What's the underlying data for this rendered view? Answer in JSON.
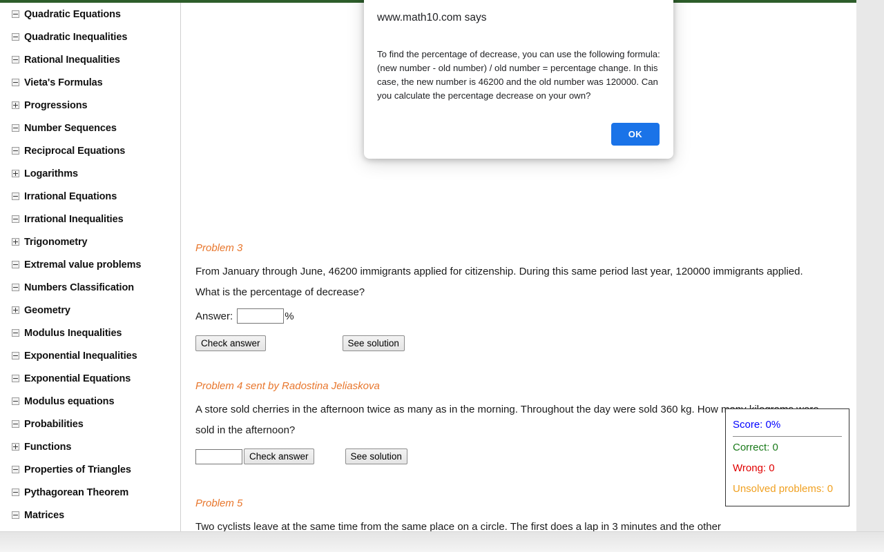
{
  "theme": {
    "top_bar_color": "#2d5d2a",
    "accent_orange": "#e8762c",
    "dialog_button_blue": "#1a73e8",
    "score_blue": "#0000ff",
    "correct_green": "#1a7a1a",
    "wrong_red": "#e00000",
    "unsolved_orange": "#f0a020"
  },
  "sidebar": {
    "items": [
      {
        "label": "Quadratic Equations",
        "toggle": "minus"
      },
      {
        "label": "Quadratic Inequalities",
        "toggle": "minus"
      },
      {
        "label": "Rational Inequalities",
        "toggle": "minus"
      },
      {
        "label": "Vieta's Formulas",
        "toggle": "minus"
      },
      {
        "label": "Progressions",
        "toggle": "plus"
      },
      {
        "label": "Number Sequences",
        "toggle": "minus"
      },
      {
        "label": "Reciprocal Equations",
        "toggle": "minus"
      },
      {
        "label": "Logarithms",
        "toggle": "plus"
      },
      {
        "label": "Irrational Equations",
        "toggle": "minus"
      },
      {
        "label": "Irrational Inequalities",
        "toggle": "minus"
      },
      {
        "label": "Trigonometry",
        "toggle": "plus"
      },
      {
        "label": "Extremal value problems",
        "toggle": "minus"
      },
      {
        "label": "Numbers Classification",
        "toggle": "minus"
      },
      {
        "label": "Geometry",
        "toggle": "plus"
      },
      {
        "label": "Modulus Inequalities",
        "toggle": "minus"
      },
      {
        "label": "Exponential Inequalities",
        "toggle": "minus"
      },
      {
        "label": "Exponential Equations",
        "toggle": "minus"
      },
      {
        "label": "Modulus equations",
        "toggle": "minus"
      },
      {
        "label": "Probabilities",
        "toggle": "minus"
      },
      {
        "label": "Functions",
        "toggle": "plus"
      },
      {
        "label": "Properties of Triangles",
        "toggle": "minus"
      },
      {
        "label": "Pythagorean Theorem",
        "toggle": "minus"
      },
      {
        "label": "Matrices",
        "toggle": "minus"
      }
    ]
  },
  "dialog": {
    "title": "www.math10.com says",
    "message": "To find the percentage of decrease, you can use the following formula: (new number - old number) / old number = percentage change. In this case, the new number is 46200 and the old number was 120000. Can you calculate the percentage decrease on your own?",
    "ok_label": "OK"
  },
  "problems": [
    {
      "title": "Problem 3",
      "body": "From January through June, 46200 immigrants applied for citizenship. During this same period last year, 120000 immigrants applied. What is the percentage of decrease?",
      "answer_label": "Answer:",
      "answer_value": "",
      "answer_placeholder": "",
      "unit_suffix": "%",
      "check_label": "Check answer",
      "solution_label": "See solution"
    },
    {
      "title": "Problem 4 sent by Radostina Jeliaskova",
      "body": "A store sold cherries in the afternoon twice as many as in the morning. Throughout the day were sold 360 kg. How many kilograms were sold in the afternoon?",
      "answer_label": "",
      "answer_value": "",
      "answer_placeholder": "",
      "unit_suffix": "",
      "check_label": "Check answer",
      "solution_label": "See solution"
    },
    {
      "title": "Problem 5",
      "body": "Two cyclists leave at the same time from the same place on a circle. The first does a lap in 3 minutes and the other",
      "answer_label": "",
      "answer_value": "",
      "answer_placeholder": "",
      "unit_suffix": "",
      "check_label": "",
      "solution_label": ""
    }
  ],
  "score_panel": {
    "score": "Score: 0%",
    "correct": "Correct: 0",
    "wrong": "Wrong: 0",
    "unsolved": "Unsolved problems: 0"
  }
}
